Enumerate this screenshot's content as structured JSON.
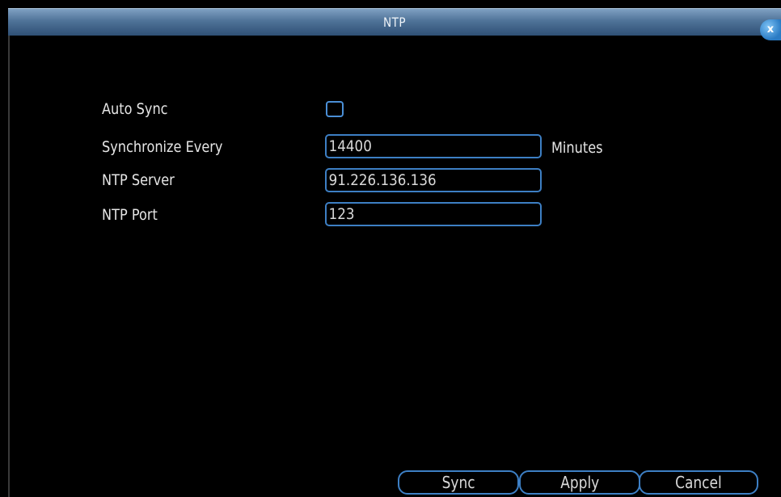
{
  "dialog": {
    "title": "NTP",
    "close_label": "x"
  },
  "form": {
    "auto_sync": {
      "label": "Auto Sync",
      "checked": false
    },
    "sync_every": {
      "label": "Synchronize Every",
      "value": "14400",
      "unit": "Minutes"
    },
    "ntp_server": {
      "label": "NTP Server",
      "value": "91.226.136.136"
    },
    "ntp_port": {
      "label": "NTP Port",
      "value": "123"
    }
  },
  "buttons": {
    "sync": "Sync",
    "apply": "Apply",
    "cancel": "Cancel"
  },
  "colors": {
    "accent": "#3d7fc4",
    "titlebar": "#4f7398",
    "background": "#000000"
  }
}
